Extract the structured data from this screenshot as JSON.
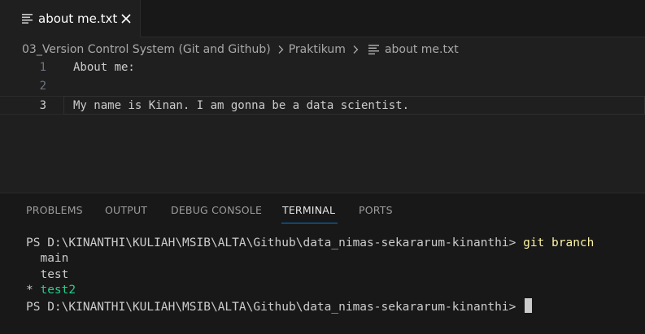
{
  "tabbar": {
    "active_tab": {
      "label": "about me.txt",
      "icon": "text-file-icon",
      "close_icon": "close-icon"
    }
  },
  "breadcrumb": {
    "items": [
      "03_Version Control System (Git and Github)",
      "Praktikum",
      "about me.txt"
    ],
    "separator_icon": "chevron-right-icon",
    "file_icon": "text-file-icon"
  },
  "editor": {
    "lines": [
      {
        "number": "1",
        "text": "About me:"
      },
      {
        "number": "2",
        "text": ""
      },
      {
        "number": "3",
        "text": "My name is Kinan. I am gonna be a data scientist."
      }
    ],
    "active_line": 3
  },
  "panel": {
    "tabs": [
      "PROBLEMS",
      "OUTPUT",
      "DEBUG CONSOLE",
      "TERMINAL",
      "PORTS"
    ],
    "active_tab": "TERMINAL"
  },
  "terminal": {
    "prompt": "PS D:\\KINANTHI\\KULIAH\\MSIB\\ALTA\\Github\\data_nimas-sekararum-kinanthi>",
    "command": "git branch",
    "branches": [
      "  main",
      "  test"
    ],
    "current_branch_marker": "* ",
    "current_branch": "test2",
    "prompt2": "PS D:\\KINANTHI\\KULIAH\\MSIB\\ALTA\\Github\\data_nimas-sekararum-kinanthi>"
  },
  "colors": {
    "background": "#1f1f1f",
    "panel_background": "#181818",
    "accent": "#0078d4",
    "command_yellow": "#f9f1a5",
    "branch_green": "#23d18b"
  }
}
